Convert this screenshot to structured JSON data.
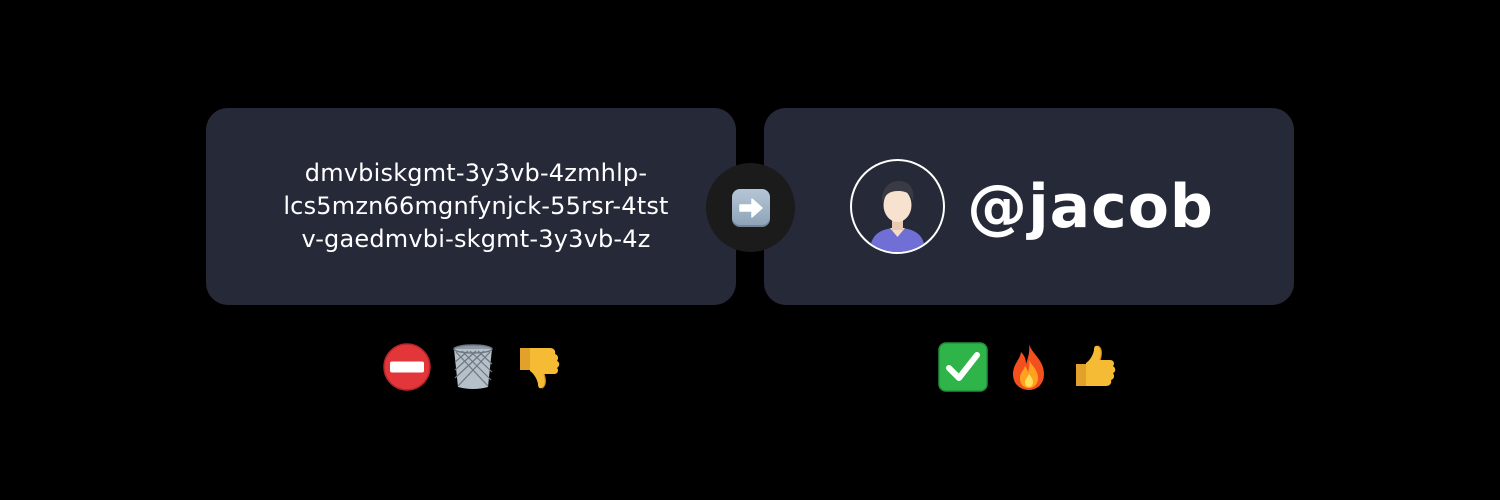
{
  "old_address": {
    "line1": "dmvbiskgmt-3y3vb-4zmhlp-",
    "line2": "lcs5mzn66mgnfynjck-55rsr-4tst",
    "line3": "v-gaedmvbi-skgmt-3y3vb-4z"
  },
  "new_identity": {
    "handle": "@jacob",
    "avatar_icon": "person-avatar-icon"
  },
  "connector_icon": "right-arrow-icon",
  "left_emojis": [
    "no-entry-icon",
    "wastebasket-icon",
    "thumbs-down-icon"
  ],
  "right_emojis": [
    "check-mark-icon",
    "fire-icon",
    "thumbs-up-icon"
  ],
  "colors": {
    "background": "#000000",
    "card": "#262938",
    "connector": "#1b1b1b",
    "text": "#ffffff"
  }
}
